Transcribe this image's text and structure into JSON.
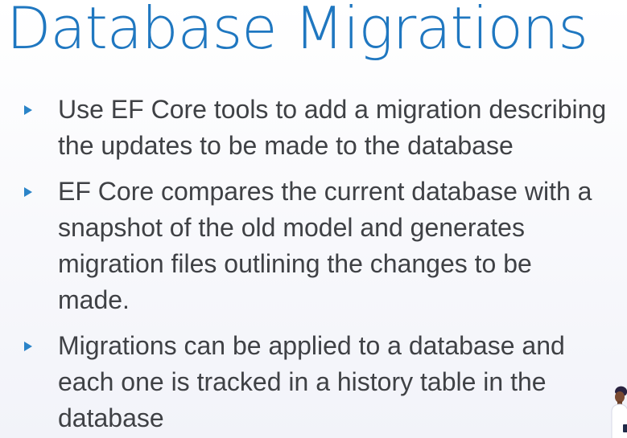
{
  "slide": {
    "title": "Database Migrations",
    "bullets": [
      {
        "lines": [
          "Use EF Core tools to add a migration describing",
          "the updates to be made to the database"
        ]
      },
      {
        "lines": [
          "EF Core compares the current database with a",
          "snapshot of the old model and generates",
          "migration files outlining the changes to be",
          "made."
        ]
      },
      {
        "lines": [
          "Migrations can be applied to a database and",
          "each one is tracked in a history table in the",
          "database"
        ]
      }
    ],
    "bullet_color": "#2b84c8",
    "title_color": "#1f77c0",
    "text_color": "#3f4145"
  },
  "icons": {
    "bullet_marker": "triangle-right-icon",
    "person_illustration": "person-illustration"
  }
}
